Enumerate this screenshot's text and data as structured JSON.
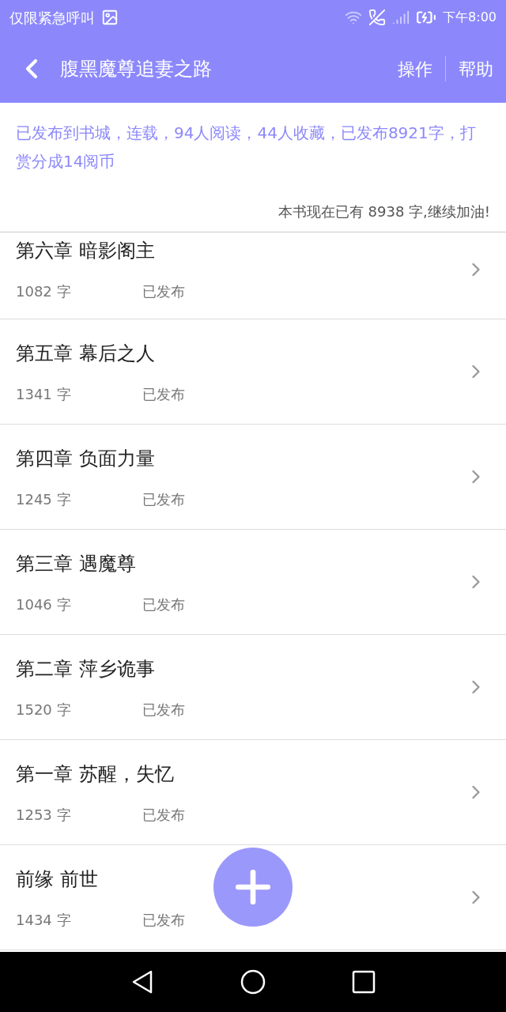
{
  "status_bar": {
    "notice": "仅限紧急呼叫",
    "time": "下午8:00"
  },
  "app_bar": {
    "title": "腹黑魔尊追妻之路",
    "actions": [
      "操作",
      "帮助"
    ]
  },
  "summary": {
    "info": "已发布到书城，连载，94人阅读，44人收藏，已发布8921字，打赏分成14阅币",
    "progress": "本书现在已有 8938 字,继续加油!"
  },
  "chapters": [
    {
      "title": "第六章  暗影阁主",
      "count": "1082 字",
      "status": "已发布"
    },
    {
      "title": "第五章  幕后之人",
      "count": "1341 字",
      "status": "已发布"
    },
    {
      "title": "第四章  负面力量",
      "count": "1245 字",
      "status": "已发布"
    },
    {
      "title": "第三章  遇魔尊",
      "count": "1046 字",
      "status": "已发布"
    },
    {
      "title": "第二章  萍乡诡事",
      "count": "1520 字",
      "status": "已发布"
    },
    {
      "title": "第一章  苏醒，失忆",
      "count": "1253 字",
      "status": "已发布"
    },
    {
      "title": "前缘  前世",
      "count": "1434 字",
      "status": "已发布"
    }
  ]
}
